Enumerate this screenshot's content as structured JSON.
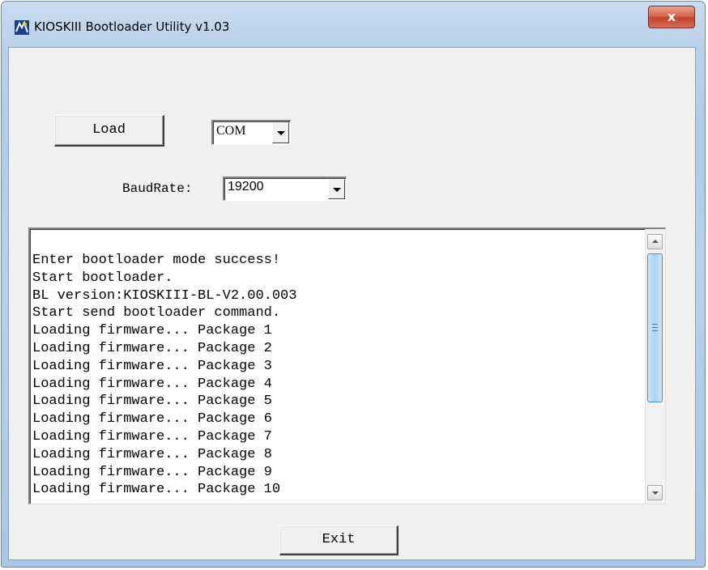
{
  "window": {
    "title": "KIOSKIII Bootloader Utility v1.03",
    "close_glyph": "x",
    "app_icon": "app-icon"
  },
  "controls": {
    "load_label": "Load",
    "port_select_value": "COM",
    "baud_label": "BaudRate:",
    "baud_select_value": "19200",
    "exit_label": "Exit"
  },
  "log": {
    "lines": [
      "Enter bootloader mode success!",
      "Start bootloader.",
      "BL version:KIOSKIII-BL-V2.00.003",
      "Start send bootloader command.",
      "Loading firmware... Package 1",
      "Loading firmware... Package 2",
      "Loading firmware... Package 3",
      "Loading firmware... Package 4",
      "Loading firmware... Package 5",
      "Loading firmware... Package 6",
      "Loading firmware... Package 7",
      "Loading firmware... Package 8",
      "Loading firmware... Package 9",
      "Loading firmware... Package 10"
    ]
  },
  "colors": {
    "close_button": "#c7462f",
    "scroll_thumb": "#a9d3f3",
    "frame": "#b9d0ea"
  }
}
